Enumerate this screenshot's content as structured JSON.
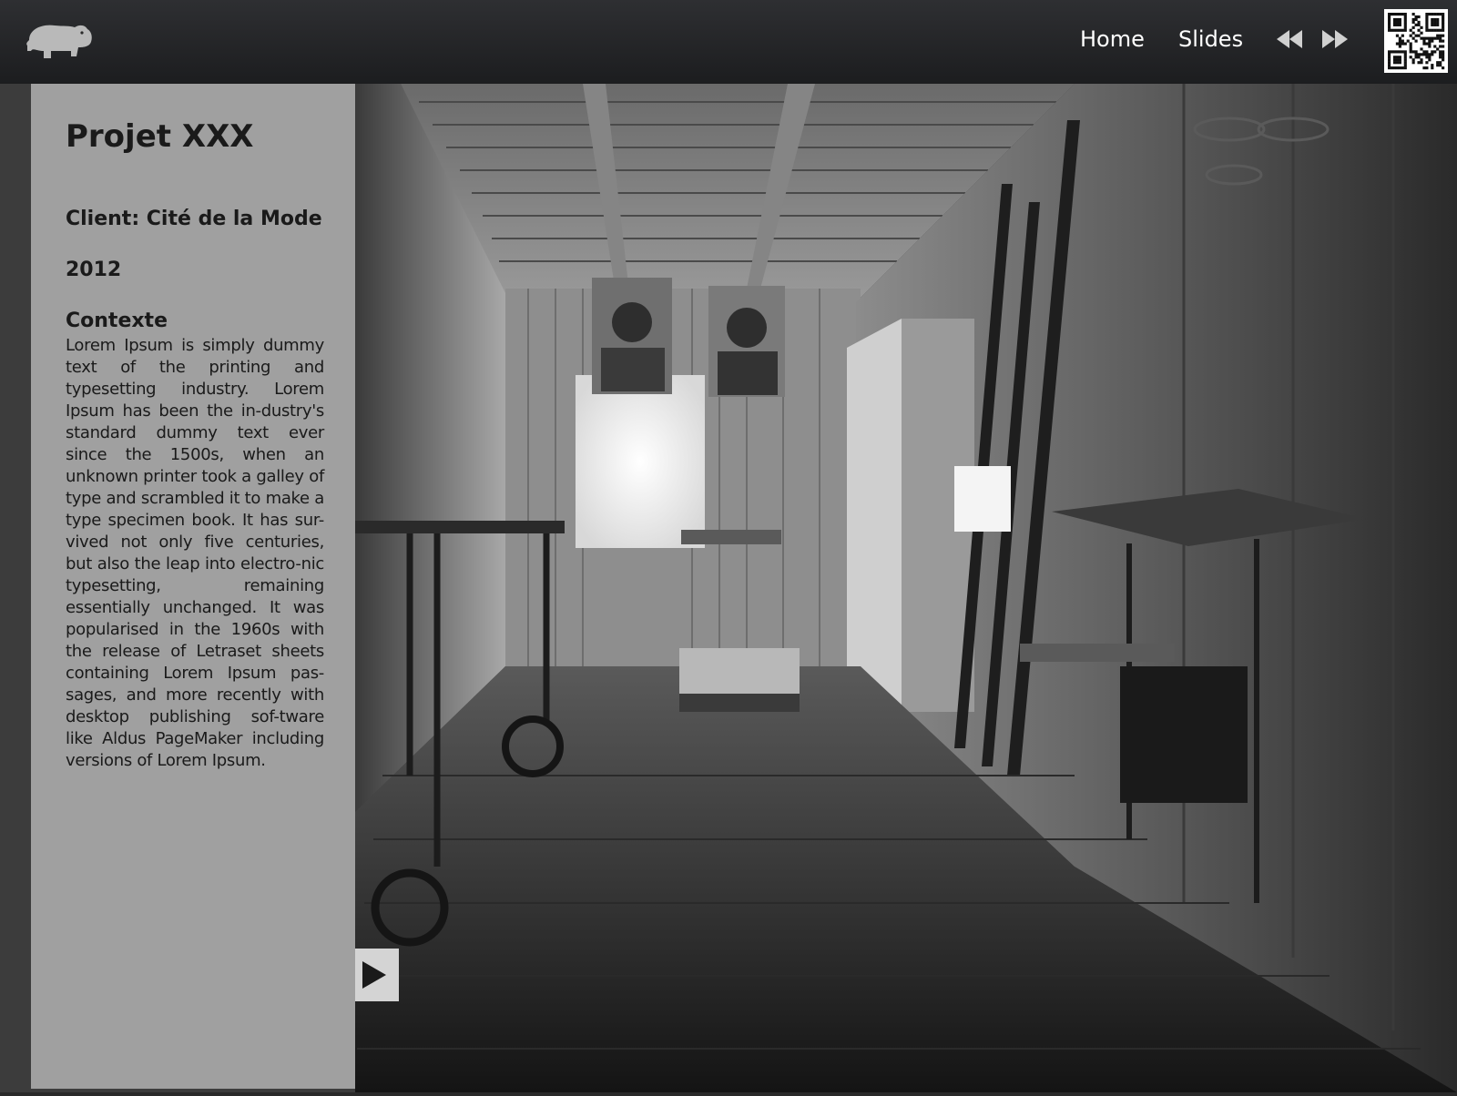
{
  "nav": {
    "home_label": "Home",
    "slides_label": "Slides",
    "prev_icon": "rewind-icon",
    "next_icon": "fast-forward-icon",
    "logo_icon": "hippo-icon",
    "qr_icon": "qr-code-icon"
  },
  "project": {
    "title": "Projet XXX",
    "client": "Client: Cité de la Mode",
    "year": "2012",
    "context_heading": "Contexte",
    "context_body": "Lorem Ipsum is simply dummy text of the printing and typesetting industry. Lorem Ipsum has been the in-dustry's standard dummy text ever since the 1500s, when an unknown printer took a galley of type and scrambled it to make a type specimen book. It has sur-vived not only five centuries, but also the leap into electro-nic typesetting, remaining essentially unchanged. It was popularised in the 1960s with the release of Letraset sheets containing Lorem Ipsum pas-sages, and more recently with desktop publishing sof-tware like Aldus PageMaker including versions of Lorem Ipsum."
  },
  "slideshow": {
    "play_icon": "play-icon"
  },
  "colors": {
    "topbar": "#252629",
    "panel": "#b6b6b6",
    "text": "#1a1a1a"
  }
}
